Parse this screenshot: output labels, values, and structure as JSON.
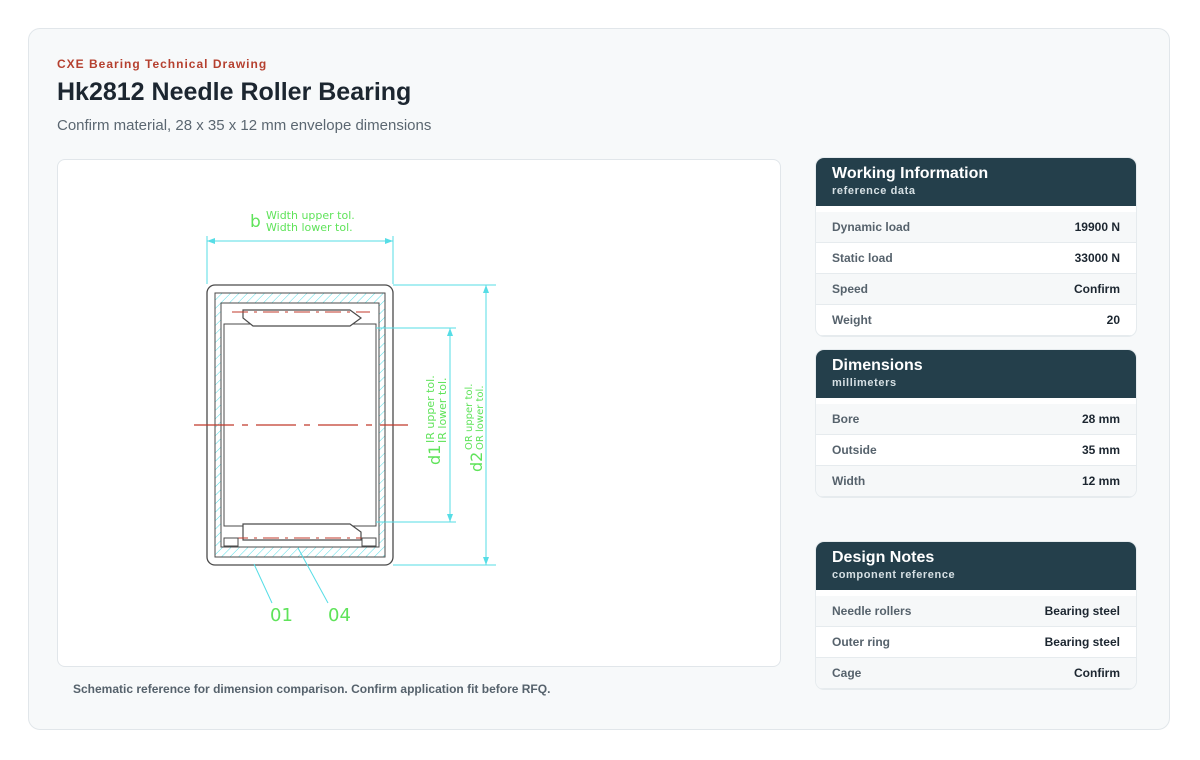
{
  "header": {
    "eyebrow": "CXE Bearing Technical Drawing",
    "title": "Hk2812 Needle Roller Bearing",
    "subtitle": "Confirm material, 28 x 35 x 12 mm envelope dimensions"
  },
  "drawing": {
    "label_b": "b",
    "label_width_upper": "Width upper tol.",
    "label_width_lower": "Width lower tol.",
    "label_d1": "d1",
    "label_ir_upper": "IR upper tol.",
    "label_ir_lower": "IR lower tol.",
    "label_d2": "d2",
    "label_or_upper": "OR upper tol.",
    "label_or_lower": "OR lower tol.",
    "callout_01": "01",
    "callout_04": "04",
    "caption": "Schematic reference for dimension comparison. Confirm application fit before RFQ.",
    "colors": {
      "dimension": "#5fe35a",
      "extension": "#56dde6",
      "outline": "#4a4a4a",
      "centerline": "#c0392b"
    }
  },
  "working": {
    "title": "Working Information",
    "subtitle": "reference data",
    "rows": [
      {
        "label": "Dynamic load",
        "value": "19900 N"
      },
      {
        "label": "Static load",
        "value": "33000 N"
      },
      {
        "label": "Speed",
        "value": "Confirm"
      },
      {
        "label": "Weight",
        "value": "20"
      }
    ]
  },
  "dimensions": {
    "title": "Dimensions",
    "subtitle": "millimeters",
    "rows": [
      {
        "label": "Bore",
        "value": "28 mm"
      },
      {
        "label": "Outside",
        "value": "35 mm"
      },
      {
        "label": "Width",
        "value": "12 mm"
      }
    ]
  },
  "notes": {
    "title": "Design Notes",
    "subtitle": "component reference",
    "rows": [
      {
        "label": "Needle rollers",
        "value": "Bearing steel"
      },
      {
        "label": "Outer ring",
        "value": "Bearing steel"
      },
      {
        "label": "Cage",
        "value": "Confirm"
      }
    ]
  },
  "theme": {
    "accent": "#b5402f",
    "header_bg": "#243f4b"
  }
}
